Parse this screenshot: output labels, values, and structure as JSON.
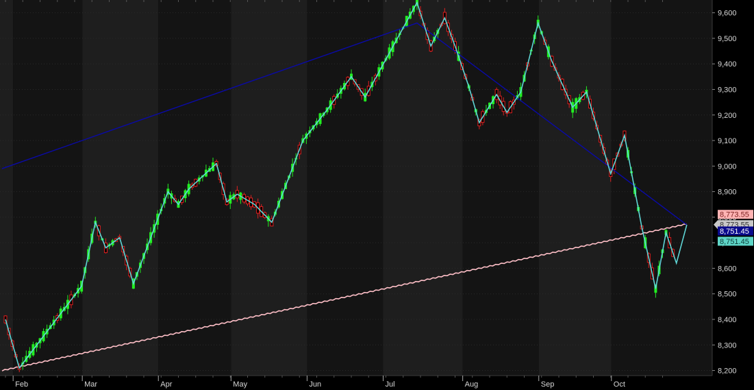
{
  "chart_data": {
    "type": "candlestick",
    "ylim": [
      8180,
      9650
    ],
    "y_ticks": [
      {
        "value": 8200,
        "label": "8,200"
      },
      {
        "value": 8300,
        "label": "8,300"
      },
      {
        "value": 8400,
        "label": "8,400"
      },
      {
        "value": 8500,
        "label": "8,500"
      },
      {
        "value": 8600,
        "label": "8,600"
      },
      {
        "value": 8700,
        "label": "8,700"
      },
      {
        "value": 8800,
        "label": "8,800"
      },
      {
        "value": 8900,
        "label": "8,900"
      },
      {
        "value": 9000,
        "label": "9,000"
      },
      {
        "value": 9100,
        "label": "9,100"
      },
      {
        "value": 9200,
        "label": "9,200"
      },
      {
        "value": 9300,
        "label": "9,300"
      },
      {
        "value": 9400,
        "label": "9,400"
      },
      {
        "value": 9500,
        "label": "9,500"
      },
      {
        "value": 9600,
        "label": "9,600"
      }
    ],
    "months": [
      {
        "label": "Feb",
        "index": 3
      },
      {
        "label": "Mar",
        "index": 23
      },
      {
        "label": "Apr",
        "index": 45
      },
      {
        "label": "May",
        "index": 66
      },
      {
        "label": "Jun",
        "index": 88
      },
      {
        "label": "Jul",
        "index": 110
      },
      {
        "label": "Aug",
        "index": 133
      },
      {
        "label": "Sep",
        "index": 155
      },
      {
        "label": "Oct",
        "index": 176
      }
    ],
    "bar_count": 194,
    "zigzag": [
      {
        "i": 0,
        "v": 8400
      },
      {
        "i": 4,
        "v": 8210
      },
      {
        "i": 22,
        "v": 8530
      },
      {
        "i": 26,
        "v": 8780
      },
      {
        "i": 29,
        "v": 8680
      },
      {
        "i": 33,
        "v": 8720
      },
      {
        "i": 37,
        "v": 8540
      },
      {
        "i": 47,
        "v": 8900
      },
      {
        "i": 50,
        "v": 8850
      },
      {
        "i": 53,
        "v": 8910
      },
      {
        "i": 57,
        "v": 8960
      },
      {
        "i": 61,
        "v": 9010
      },
      {
        "i": 64,
        "v": 8860
      },
      {
        "i": 67,
        "v": 8890
      },
      {
        "i": 72,
        "v": 8850
      },
      {
        "i": 77,
        "v": 8780
      },
      {
        "i": 86,
        "v": 9100
      },
      {
        "i": 93,
        "v": 9220
      },
      {
        "i": 100,
        "v": 9350
      },
      {
        "i": 104,
        "v": 9270
      },
      {
        "i": 119,
        "v": 9640
      },
      {
        "i": 123,
        "v": 9470
      },
      {
        "i": 127,
        "v": 9580
      },
      {
        "i": 130,
        "v": 9470
      },
      {
        "i": 134,
        "v": 9310
      },
      {
        "i": 137,
        "v": 9170
      },
      {
        "i": 142,
        "v": 9280
      },
      {
        "i": 145,
        "v": 9210
      },
      {
        "i": 149,
        "v": 9290
      },
      {
        "i": 154,
        "v": 9560
      },
      {
        "i": 158,
        "v": 9410
      },
      {
        "i": 164,
        "v": 9230
      },
      {
        "i": 168,
        "v": 9290
      },
      {
        "i": 175,
        "v": 8970
      },
      {
        "i": 179,
        "v": 9120
      },
      {
        "i": 184,
        "v": 8760
      },
      {
        "i": 188,
        "v": 8520
      },
      {
        "i": 191,
        "v": 8740
      },
      {
        "i": 194,
        "v": 8620
      },
      {
        "i": 197,
        "v": 8770
      }
    ],
    "blue_line": [
      {
        "i": -1,
        "v": 8990
      },
      {
        "i": 119,
        "v": 9560
      },
      {
        "i": 197,
        "v": 8770
      }
    ],
    "pink_line": [
      {
        "i": -1,
        "v": 8200
      },
      {
        "i": 197,
        "v": 8773.55
      }
    ],
    "price_tags": [
      {
        "label": "8,773.55",
        "value": 8773.55,
        "bg": "#ffb3b3",
        "fg": "#7a2020"
      },
      {
        "label": "8,773.55",
        "value": 8773.55,
        "bg": "#c8c8c8",
        "fg": "#333333",
        "pointer": true
      },
      {
        "label": "8,751.45",
        "value": 8751.45,
        "bg": "#0a0a8c",
        "fg": "#ffffff"
      },
      {
        "label": "8,751.45",
        "value": 8751.45,
        "bg": "#5fd6c8",
        "fg": "#0b3a36"
      }
    ],
    "colors": {
      "up": "#22ee22",
      "down": "#e02020",
      "zigzag": "#5fd6d6",
      "blue_line": "#0a0aa8",
      "pink_line": "#ffc0c8",
      "band_dark": "#141414",
      "band_light": "#1e1e1e"
    }
  }
}
